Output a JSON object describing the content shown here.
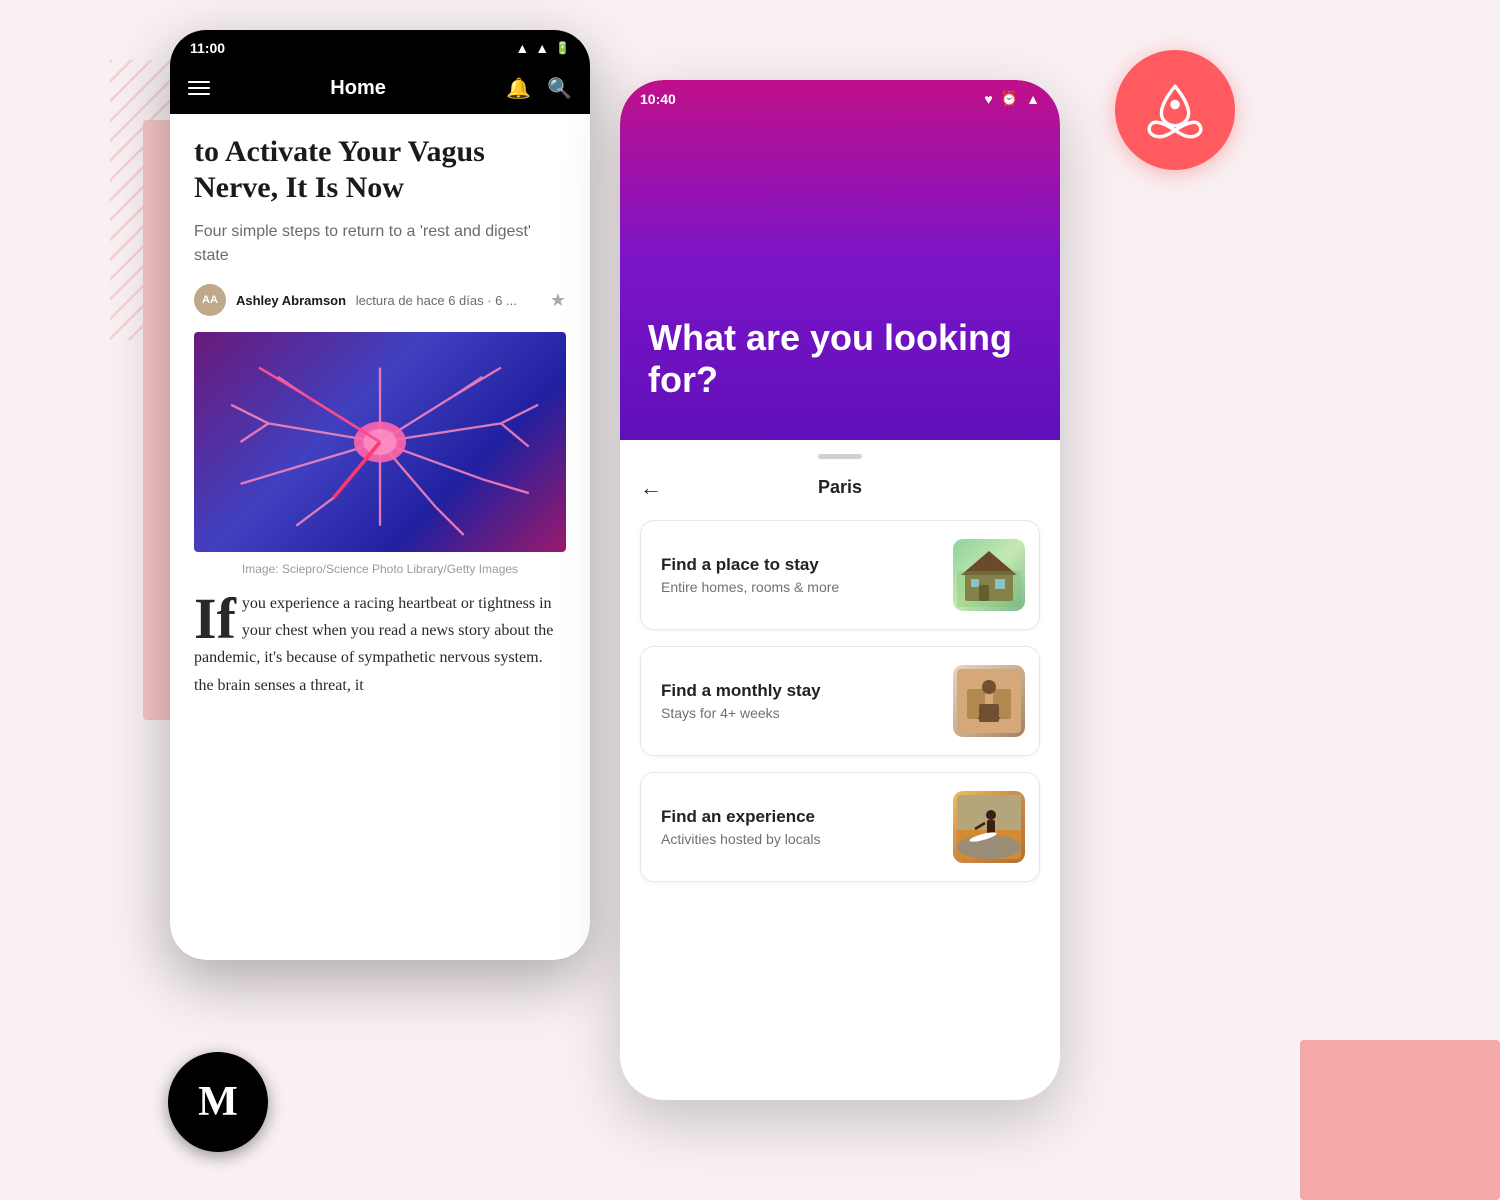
{
  "background": {
    "stripes_color": "#f7c5c5",
    "pink_rect_color": "#f7c5c5",
    "bottom_right_color": "#f4a9a8"
  },
  "medium_phone": {
    "status_bar": {
      "time": "11:00",
      "signal_icon": "signal-icon",
      "wifi_icon": "wifi-icon",
      "battery_icon": "battery-icon"
    },
    "nav": {
      "menu_icon": "menu-icon",
      "title": "Home",
      "notification_icon": "notification-icon",
      "search_icon": "search-icon"
    },
    "article": {
      "title": "to Activate Your Vagus Nerve, It Is Now",
      "subtitle": "Four simple steps to return to a 'rest and digest' state",
      "author_name": "Ashley Abramson",
      "author_meta": "lectura de hace 6 días · 6 ...",
      "image_caption": "Image: Sciepro/Science Photo Library/Getty Images",
      "body_text": "you experience a racing heartbeat or tightness in your chest when you read a news story about the pandemic, it's because of sympathetic nervous system. the brain senses a threat, it",
      "dropcap": "If"
    }
  },
  "medium_badge": {
    "letter": "M"
  },
  "airbnb_phone": {
    "status_bar": {
      "time": "10:40",
      "heart_icon": "heart-icon",
      "alarm_icon": "alarm-icon",
      "wifi_icon": "wifi-icon"
    },
    "header": {
      "question": "What are you looking for?"
    },
    "sheet": {
      "back_icon": "back-arrow-icon",
      "location": "Paris"
    },
    "cards": [
      {
        "title": "Find a place to stay",
        "subtitle": "Entire homes, rooms & more",
        "image_type": "house"
      },
      {
        "title": "Find a monthly stay",
        "subtitle": "Stays for 4+ weeks",
        "image_type": "kitchen"
      },
      {
        "title": "Find an experience",
        "subtitle": "Activities hosted by locals",
        "image_type": "surfer"
      }
    ]
  },
  "airbnb_logo": {
    "aria": "airbnb-logo"
  }
}
